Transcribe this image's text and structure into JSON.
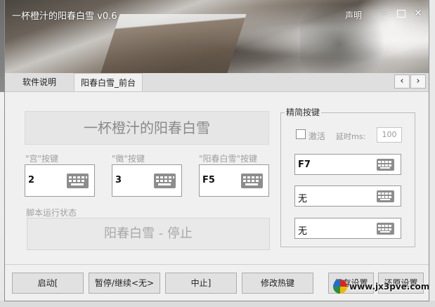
{
  "window": {
    "title": "一杯橙汁的阳春白雪 v0.6",
    "help_link": "声明",
    "controls": {
      "minimize": "–",
      "close": "✕"
    }
  },
  "tabs": [
    {
      "label": "软件说明",
      "selected": false
    },
    {
      "label": "阳春白雪_前台",
      "selected": true
    }
  ],
  "tab_scroll": {
    "prev": "‹",
    "next": "›"
  },
  "main": {
    "banner": "一杯橙汁的阳春白雪",
    "fields": [
      {
        "label": "\"宫\"按键",
        "value": "2",
        "icon": "keyboard-icon"
      },
      {
        "label": "\"徵\"按键",
        "value": "3",
        "icon": "keyboard-icon"
      },
      {
        "label": "\"阳春白雪\"按键",
        "value": "F5",
        "icon": "keyboard-icon"
      }
    ],
    "status_label": "脚本运行状态",
    "status_value": "阳春白雪 - 停止"
  },
  "simple_keys": {
    "title": "精简按键",
    "activate_label": "激活",
    "activate_checked": false,
    "delay_label": "延时ms:",
    "delay_value": "100",
    "keys": [
      {
        "value": "F7",
        "icon": "keyboard-icon"
      },
      {
        "value": "无",
        "icon": "keyboard-icon"
      },
      {
        "value": "无",
        "icon": "keyboard-icon"
      }
    ]
  },
  "buttons": {
    "start": "启动[",
    "pause": "暂停/继续<无>",
    "stop": "中止]",
    "hotkey": "修改热键",
    "save": "保存设置",
    "restore": "还原设置"
  },
  "watermark": "www.jx3pve.com",
  "colors": {
    "banner_text": "#8a8a8a",
    "status_text": "#a8a8a8",
    "label_gray": "#a0a0a0",
    "panel_bg": "#f0f0f0"
  }
}
